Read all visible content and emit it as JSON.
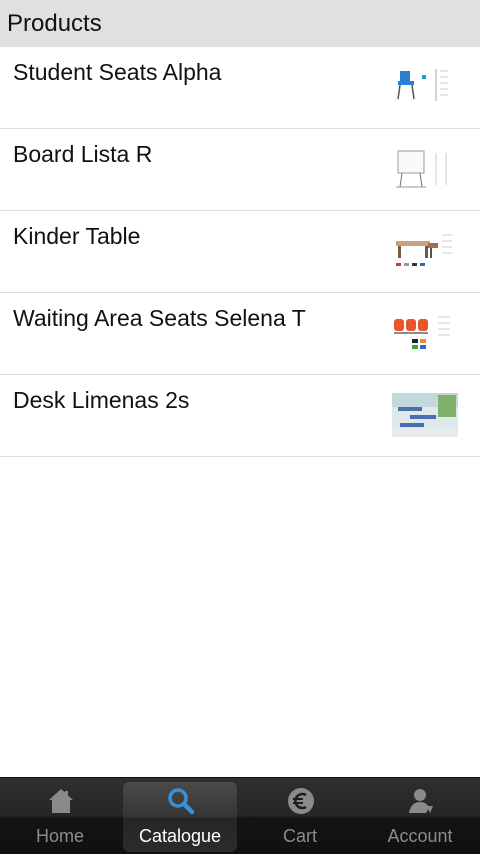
{
  "header": {
    "title": "Products"
  },
  "products": [
    {
      "name": "Student Seats Alpha",
      "thumb_icon": "blue-chair-icon"
    },
    {
      "name": "Board Lista R",
      "thumb_icon": "whiteboard-icon"
    },
    {
      "name": "Kinder Table",
      "thumb_icon": "kids-table-icon"
    },
    {
      "name": "Waiting Area Seats Selena T",
      "thumb_icon": "orange-seats-icon"
    },
    {
      "name": "Desk Limenas 2s",
      "thumb_icon": "classroom-desks-icon"
    }
  ],
  "tabs": [
    {
      "label": "Home",
      "icon": "home-icon",
      "active": false
    },
    {
      "label": "Catalogue",
      "icon": "search-icon",
      "active": true
    },
    {
      "label": "Cart",
      "icon": "euro-icon",
      "active": false
    },
    {
      "label": "Account",
      "icon": "user-icon",
      "active": false
    }
  ],
  "colors": {
    "accent": "#3a8fd6",
    "header_bg": "#e0e0e0",
    "tabbar_bg": "#1a1a1a"
  }
}
